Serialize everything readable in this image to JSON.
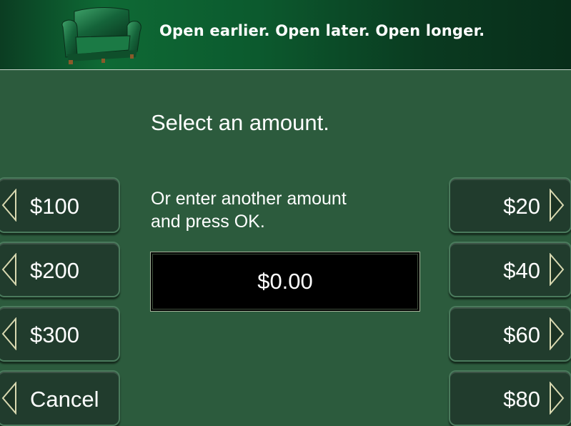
{
  "banner": {
    "slogan": "Open earlier. Open later. Open longer.",
    "logo_icon": "armchair-icon"
  },
  "main": {
    "title": "Select an amount.",
    "instruction_line1": "Or enter another amount",
    "instruction_line2": "and press OK.",
    "amount_value": "$0.00"
  },
  "left_buttons": [
    {
      "label": "$100"
    },
    {
      "label": "$200"
    },
    {
      "label": "$300"
    },
    {
      "label": "Cancel"
    }
  ],
  "right_buttons": [
    {
      "label": "$20"
    },
    {
      "label": "$40"
    },
    {
      "label": "$60"
    },
    {
      "label": "$80"
    }
  ],
  "colors": {
    "background": "#2c5b3d",
    "button_fill": "#213c2d",
    "arrow": "#d8d8b0",
    "amount_box": "#000000"
  },
  "icons": {
    "left_arrow": "left-triangle-arrow-icon",
    "right_arrow": "right-triangle-arrow-icon"
  }
}
